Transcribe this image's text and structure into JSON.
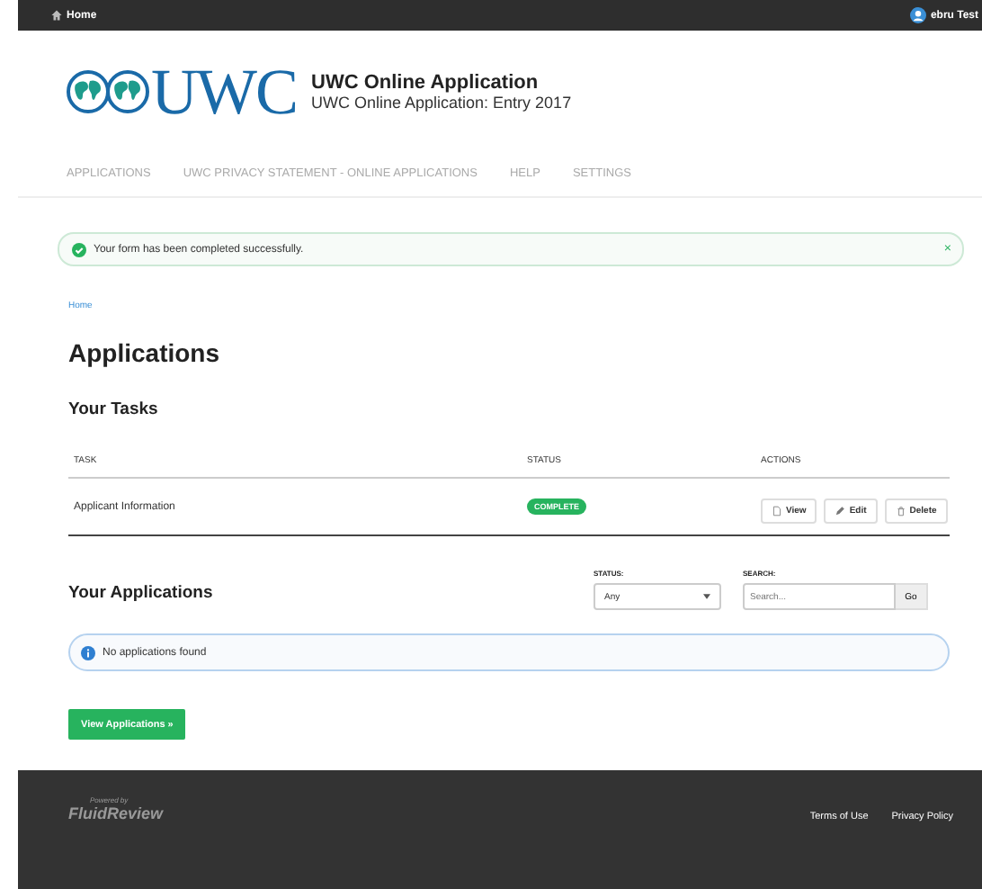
{
  "top_bar": {
    "home_link": "Home",
    "user": "ebru Test"
  },
  "header": {
    "logo_text": "UWC",
    "title": "UWC Online Application",
    "subtitle": "UWC Online Application: Entry 2017"
  },
  "nav": {
    "items": [
      {
        "label": "APPLICATIONS"
      },
      {
        "label": "UWC PRIVACY STATEMENT - ONLINE APPLICATIONS"
      },
      {
        "label": "HELP"
      },
      {
        "label": "SETTINGS"
      }
    ]
  },
  "alert": {
    "message": "Your form has been completed successfully.",
    "close": "×"
  },
  "breadcrumb": [
    "Home"
  ],
  "page_title": "Applications",
  "tasks": {
    "heading": "Your Tasks",
    "columns": [
      "TASK",
      "STATUS",
      "ACTIONS"
    ],
    "rows": [
      {
        "task": "Applicant Information",
        "status": "COMPLETE",
        "actions": [
          {
            "kind": "view",
            "label": "View"
          },
          {
            "kind": "edit",
            "label": "Edit"
          },
          {
            "kind": "delete",
            "label": "Delete"
          }
        ]
      }
    ]
  },
  "applications": {
    "heading": "Your Applications",
    "status_filter": {
      "label": "STATUS:",
      "value": "Any"
    },
    "search": {
      "label": "SEARCH:",
      "placeholder": "Search...",
      "button": "Go"
    },
    "empty_message": "No applications found",
    "button": "View Applications »"
  },
  "footer": {
    "powered_by": "Powered by",
    "brand": "FluidReview",
    "links": [
      "Terms of Use",
      "Privacy Policy"
    ]
  }
}
